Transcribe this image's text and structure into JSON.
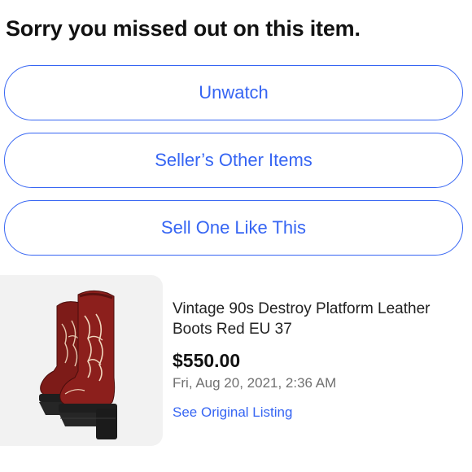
{
  "header": {
    "title": "Sorry you missed out on this item."
  },
  "actions": {
    "unwatch_label": "Unwatch",
    "seller_items_label": "Seller’s Other Items",
    "sell_like_label": "Sell One Like This"
  },
  "listing": {
    "title": "Vintage 90s Destroy Platform Leather Boots Red EU 37",
    "price": "$550.00",
    "date": "Fri, Aug 20, 2021, 2:36 AM",
    "link_label": "See Original Listing",
    "image_icon": "boots-photo"
  },
  "colors": {
    "accent": "#3665f3",
    "boot_red": "#8c1f1c",
    "sole": "#1e1e1e",
    "thumb_bg": "#f2f2f2"
  }
}
